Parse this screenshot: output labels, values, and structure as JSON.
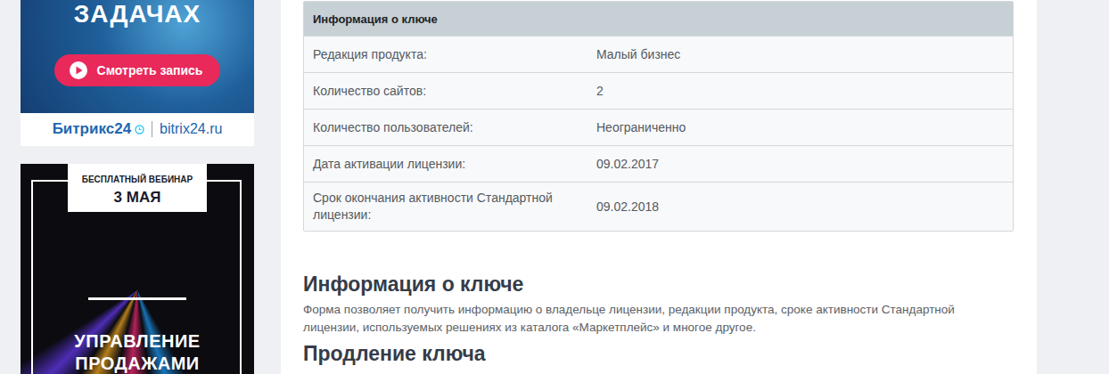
{
  "ads": [
    {
      "kind": "recording",
      "title": "ЗАДАЧАХ",
      "button": "Смотреть запись",
      "brand": "Битрикс24",
      "site": "bitrix24.ru"
    },
    {
      "kind": "webinar",
      "badge": "БЕСПЛАТНЫЙ ВЕБИНАР",
      "date": "3 МАЯ",
      "title": "УПРАВЛЕНИЕ ПРОДАЖАМИ"
    }
  ],
  "table": {
    "title": "Информация о ключе",
    "rows": [
      {
        "label": "Редакция продукта:",
        "value": "Малый бизнес"
      },
      {
        "label": "Количество сайтов:",
        "value": "2"
      },
      {
        "label": "Количество пользователей:",
        "value": "Неограниченно"
      },
      {
        "label": "Дата активации лицензии:",
        "value": "09.02.2017"
      },
      {
        "label": "Срок окончания активности Стандартной лицензии:",
        "value": "09.02.2018"
      }
    ]
  },
  "sections": [
    {
      "heading": "Информация о ключе",
      "text": "Форма позволяет получить информацию о владельце лицензии, редакции продукта, сроке активности Стандартной лицензии, используемых решениях из каталога «Маркетплейс» и многое другое."
    },
    {
      "heading": "Продление ключа",
      "text": ""
    }
  ]
}
